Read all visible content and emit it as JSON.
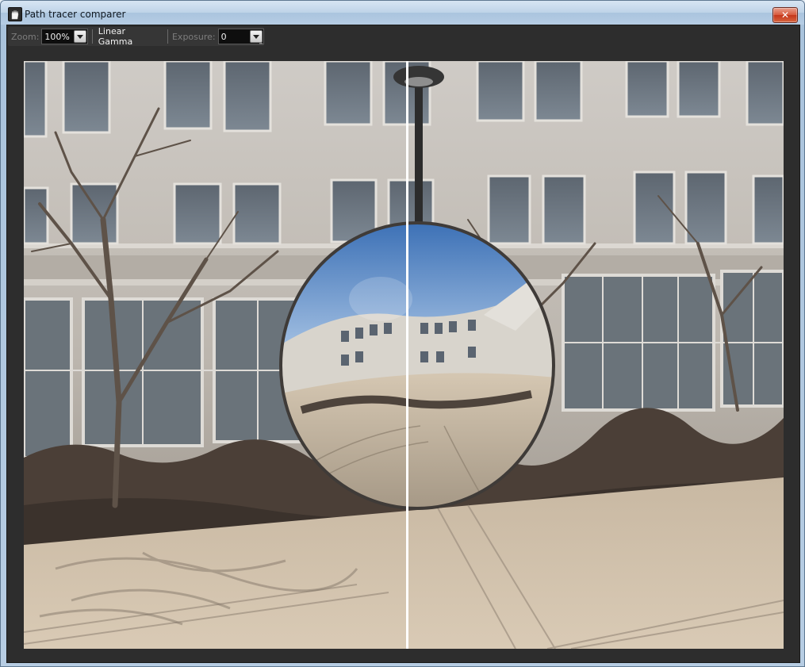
{
  "window": {
    "title": "Path tracer comparer",
    "close_glyph": "✕",
    "icon": "hand-icon"
  },
  "toolbar": {
    "zoom_label": "Zoom:",
    "zoom_value": "100%",
    "gamma_toggle": "Linear Gamma",
    "exposure_label": "Exposure:",
    "exposure_value": "0"
  },
  "viewport": {
    "split_fraction": 0.505
  },
  "colors": {
    "client_bg": "#2d2d2d",
    "toolbar_bg": "#363636",
    "label_disabled": "#7d7d7d",
    "text_on_dark": "#f0f0f0",
    "divider": "#ffffff"
  }
}
